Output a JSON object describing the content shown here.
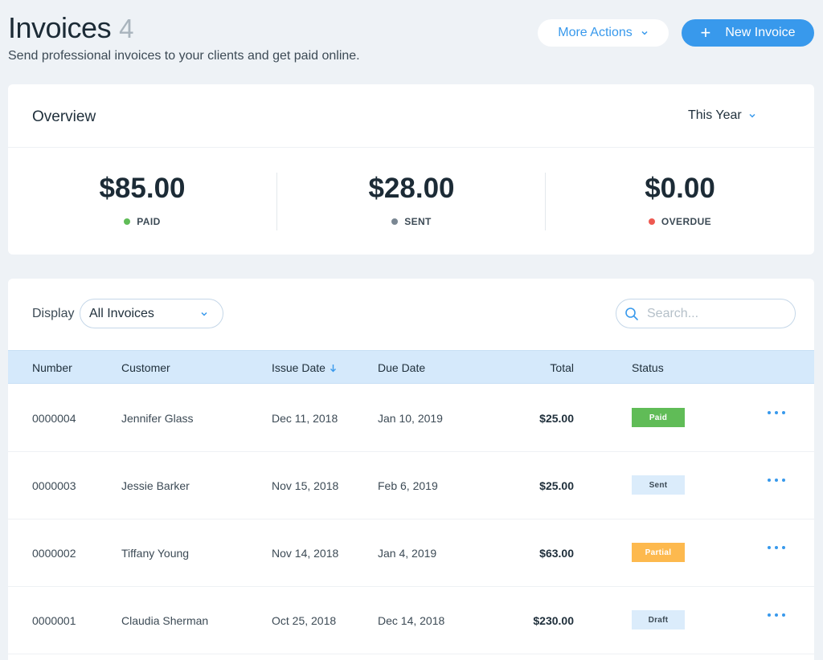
{
  "header": {
    "title": "Invoices",
    "count": "4",
    "subtitle": "Send professional invoices to your clients and get paid online.",
    "more_actions_label": "More Actions",
    "new_invoice_label": "New Invoice"
  },
  "overview": {
    "title": "Overview",
    "period": "This Year",
    "stats": [
      {
        "amount": "$85.00",
        "label": "PAID",
        "color": "#60bc57"
      },
      {
        "amount": "$28.00",
        "label": "SENT",
        "color": "#7a8793"
      },
      {
        "amount": "$0.00",
        "label": "OVERDUE",
        "color": "#ee5951"
      }
    ]
  },
  "list": {
    "display_label": "Display",
    "display_value": "All Invoices",
    "search_placeholder": "Search...",
    "columns": {
      "number": "Number",
      "customer": "Customer",
      "issue_date": "Issue Date",
      "due_date": "Due Date",
      "total": "Total",
      "status": "Status"
    },
    "rows": [
      {
        "number": "0000004",
        "customer": "Jennifer Glass",
        "issue_date": "Dec 11, 2018",
        "due_date": "Jan 10, 2019",
        "total": "$25.00",
        "status": "Paid"
      },
      {
        "number": "0000003",
        "customer": "Jessie Barker",
        "issue_date": "Nov 15, 2018",
        "due_date": "Feb 6, 2019",
        "total": "$25.00",
        "status": "Sent"
      },
      {
        "number": "0000002",
        "customer": "Tiffany Young",
        "issue_date": "Nov 14, 2018",
        "due_date": "Jan 4, 2019",
        "total": "$63.00",
        "status": "Partial"
      },
      {
        "number": "0000001",
        "customer": "Claudia Sherman",
        "issue_date": "Oct 25, 2018",
        "due_date": "Dec 14, 2018",
        "total": "$230.00",
        "status": "Draft"
      }
    ]
  },
  "status_styles": {
    "Paid": {
      "bg": "#60bc57",
      "fg": "#ffffff"
    },
    "Sent": {
      "bg": "#dbecfb",
      "fg": "#3c4a55"
    },
    "Partial": {
      "bg": "#fdb94e",
      "fg": "#ffffff"
    },
    "Draft": {
      "bg": "#dbecfb",
      "fg": "#3c4a55"
    }
  },
  "accent_color": "#3899ec"
}
